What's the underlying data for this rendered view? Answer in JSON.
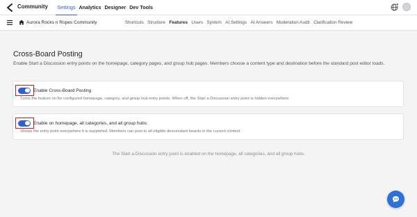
{
  "app": {
    "brand_name": "Community",
    "icons": {
      "logo": "chevron-left-logo",
      "globe": "globe-plus-icon",
      "avatar": "avatar"
    }
  },
  "topnav": {
    "items": [
      {
        "label": "Settings",
        "active": true
      },
      {
        "label": "Analytics"
      },
      {
        "label": "Designer"
      },
      {
        "label": "Dev Tools"
      }
    ]
  },
  "subbar": {
    "community_name": "Aurora Rocks n Ropes Community",
    "icons": {
      "menu": "hamburger-icon",
      "home": "home-icon"
    },
    "tabs": [
      {
        "label": "Shortcuts"
      },
      {
        "label": "Structure"
      },
      {
        "label": "Features",
        "active": true
      },
      {
        "label": "Users"
      },
      {
        "label": "System"
      },
      {
        "label": "AI Settings"
      },
      {
        "label": "AI Answers"
      },
      {
        "label": "Moderation Audit"
      },
      {
        "label": "Clarification Review"
      }
    ]
  },
  "page": {
    "title": "Cross-Board Posting",
    "description": "Enable Start a Discussion entry points on the homepage, category pages, and group hub pages. Members choose a content type and destination before the standard post editor loads."
  },
  "settings": [
    {
      "label": "Enable Cross-Board Posting",
      "description": "Turns the feature on for configured homepage, category, and group hub entry points. When off, the Start a Discussion entry point is hidden everywhere.",
      "enabled": true
    },
    {
      "label": "Enable on homepage, all categories, and all group hubs",
      "description": "Shows the entry point everywhere it is supported. Members can post to all eligible descendant boards in the current context.",
      "enabled": true
    }
  ],
  "footer_note": "The Start a Discussion entry point is enabled on the homepage, all categories, and all group hubs.",
  "colors": {
    "accent": "#2f5fd0",
    "highlight": "#d21a1a",
    "chat_fab": "#2f6fd8",
    "background": "#f4f4f5"
  },
  "chat": {
    "icon": "chat-bubble-icon"
  }
}
